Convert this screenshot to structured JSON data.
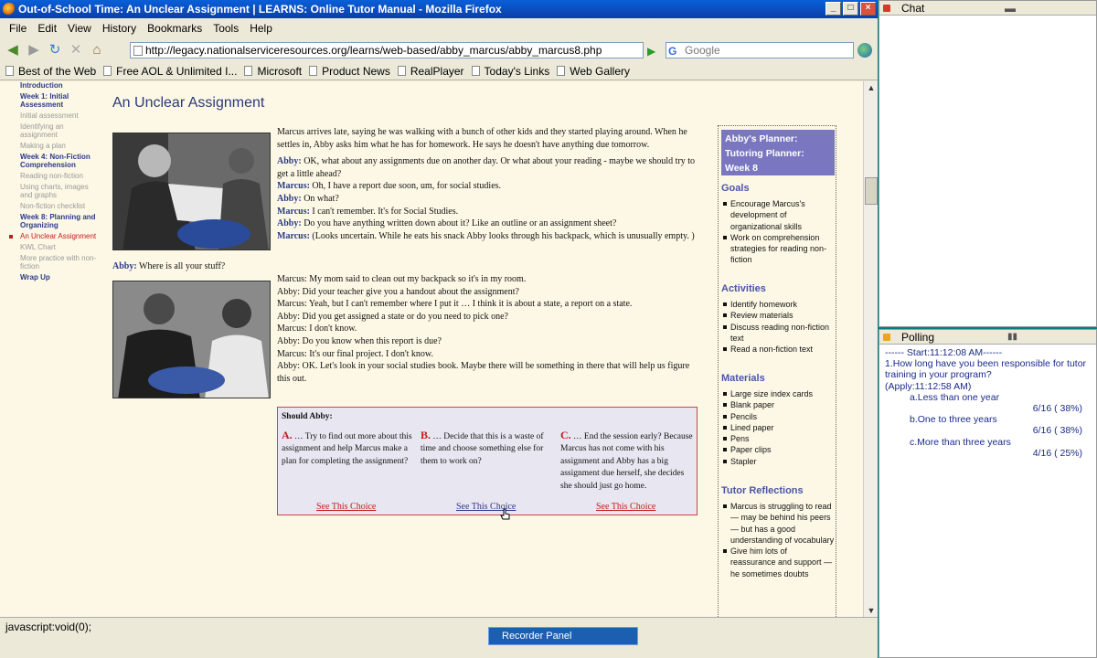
{
  "window": {
    "title": "Out-of-School Time: An Unclear Assignment | LEARNS: Online Tutor Manual - Mozilla Firefox"
  },
  "menu": [
    "File",
    "Edit",
    "View",
    "History",
    "Bookmarks",
    "Tools",
    "Help"
  ],
  "nav": {
    "url": "http://legacy.nationalserviceresources.org/learns/web-based/abby_marcus/abby_marcus8.php",
    "search_placeholder": "Google"
  },
  "bookmarks": [
    "Best of the Web",
    "Free AOL & Unlimited I...",
    "Microsoft",
    "Product News",
    "RealPlayer",
    "Today's Links",
    "Web Gallery"
  ],
  "leftnav": [
    {
      "label": "Introduction",
      "kind": "h"
    },
    {
      "label": "Week 1: Initial Assessment",
      "kind": "h"
    },
    {
      "label": "Initial assessment",
      "kind": "s"
    },
    {
      "label": "Identifying an assignment",
      "kind": "s"
    },
    {
      "label": "Making a plan",
      "kind": "s"
    },
    {
      "label": "Week 4: Non-Fiction Comprehension",
      "kind": "h"
    },
    {
      "label": "Reading non-fiction",
      "kind": "s"
    },
    {
      "label": "Using charts, images and graphs",
      "kind": "s"
    },
    {
      "label": "Non-fiction checklist",
      "kind": "s"
    },
    {
      "label": "Week 8: Planning and Organizing",
      "kind": "h"
    },
    {
      "label": "An Unclear Assignment",
      "kind": "cur"
    },
    {
      "label": "KWL Chart",
      "kind": "s"
    },
    {
      "label": "More practice with non-fiction",
      "kind": "s"
    },
    {
      "label": "Wrap Up",
      "kind": "h"
    }
  ],
  "page": {
    "title": "An Unclear Assignment",
    "intro": "Marcus arrives late, saying he was walking with a bunch of other kids and they started playing around. When he settles in, Abby asks him what he has for homework. He says he doesn't have anything due tomorrow.",
    "dialogue1": [
      {
        "speaker": "Abby:",
        "text": "OK, what about any assignments due on another day. Or what about your reading - maybe we should try to get a little ahead?"
      },
      {
        "speaker": "Marcus:",
        "text": "Oh, I have a report due soon, um, for social studies."
      },
      {
        "speaker": "Abby:",
        "text": "On what?"
      },
      {
        "speaker": "Marcus:",
        "text": "I can't remember. It's for Social Studies."
      },
      {
        "speaker": "Abby:",
        "text": "Do you have anything written down about it? Like an outline or an assignment sheet?"
      },
      {
        "speaker": "Marcus:",
        "text": "(Looks uncertain. While he eats his snack Abby looks through his backpack, which is unusually empty. )"
      }
    ],
    "caption": {
      "speaker": "Abby:",
      "text": "Where is all your stuff?"
    },
    "dialogue2": [
      {
        "speaker": "Marcus:",
        "text": "My mom said to clean out my backpack so it's in my room."
      },
      {
        "speaker": "Abby:",
        "text": "Did your teacher give you a handout about the assignment?"
      },
      {
        "speaker": "Marcus:",
        "text": "Yeah, but I can't remember where I put it … I think it is about a state, a report on a state."
      },
      {
        "speaker": "Abby:",
        "text": "Did you get assigned a state or do you need to pick one?"
      },
      {
        "speaker": "Marcus:",
        "text": "I don't know."
      },
      {
        "speaker": "Abby:",
        "text": "Do you know when this report is due?"
      },
      {
        "speaker": "Marcus:",
        "text": "It's our final project. I don't know."
      },
      {
        "speaker": "Abby:",
        "text": "OK. Let's look in your social studies book. Maybe there will be something in there that will help us figure this out."
      }
    ],
    "choices": {
      "heading": "Should Abby:",
      "items": [
        {
          "letter": "A.",
          "text": "… Try to find out more about this assignment and help Marcus make a plan for completing the assignment?",
          "link": "See This Choice"
        },
        {
          "letter": "B.",
          "text": "… Decide that this is a waste of time and choose something else for them to work on?",
          "link": "See This Choice"
        },
        {
          "letter": "C.",
          "text": "… End the session early? Because Marcus has not come with his assignment and Abby has a big assignment due herself, she decides she should just go home.",
          "link": "See This Choice"
        }
      ]
    }
  },
  "planner": {
    "title": "Abby's Planner: Tutoring Planner: Week 8",
    "goals_label": "Goals",
    "goals": [
      "Encourage Marcus's development of organizational skills",
      "Work on comprehension strategies for reading non-fiction"
    ],
    "activities_label": "Activities",
    "activities": [
      "Identify homework",
      "Review materials",
      "Discuss reading non-fiction text",
      "Read a non-fiction text"
    ],
    "materials_label": "Materials",
    "materials": [
      "Large size index cards",
      "Blank paper",
      "Pencils",
      "Lined paper",
      "Pens",
      "Paper clips",
      "Stapler"
    ],
    "reflections_label": "Tutor Reflections",
    "reflections": [
      "Marcus is struggling to read — may be behind his peers — but has a good understanding of vocabulary",
      "Give him lots of reassurance and support — he sometimes doubts"
    ]
  },
  "status": {
    "text": "javascript:void(0);"
  },
  "taskbar": {
    "item": "Recorder Panel"
  },
  "chat": {
    "title": "Chat"
  },
  "polling": {
    "title": "Polling",
    "start": "------ Start:11:12:08 AM------",
    "question": "1.How long have you been responsible for tutor training in your program?",
    "apply": "(Apply:11:12:58 AM)",
    "options": [
      {
        "label": "a.Less than one year",
        "result": "6/16 ( 38%)"
      },
      {
        "label": "b.One to three years",
        "result": "6/16 ( 38%)"
      },
      {
        "label": "c.More than three years",
        "result": "4/16 ( 25%)"
      }
    ]
  },
  "colors": {
    "accent": "#2a3a8a",
    "link": "#c21b1b",
    "planner_header": "#7a77c0",
    "page_bg": "#fdf8e5",
    "desktop": "#008080"
  }
}
